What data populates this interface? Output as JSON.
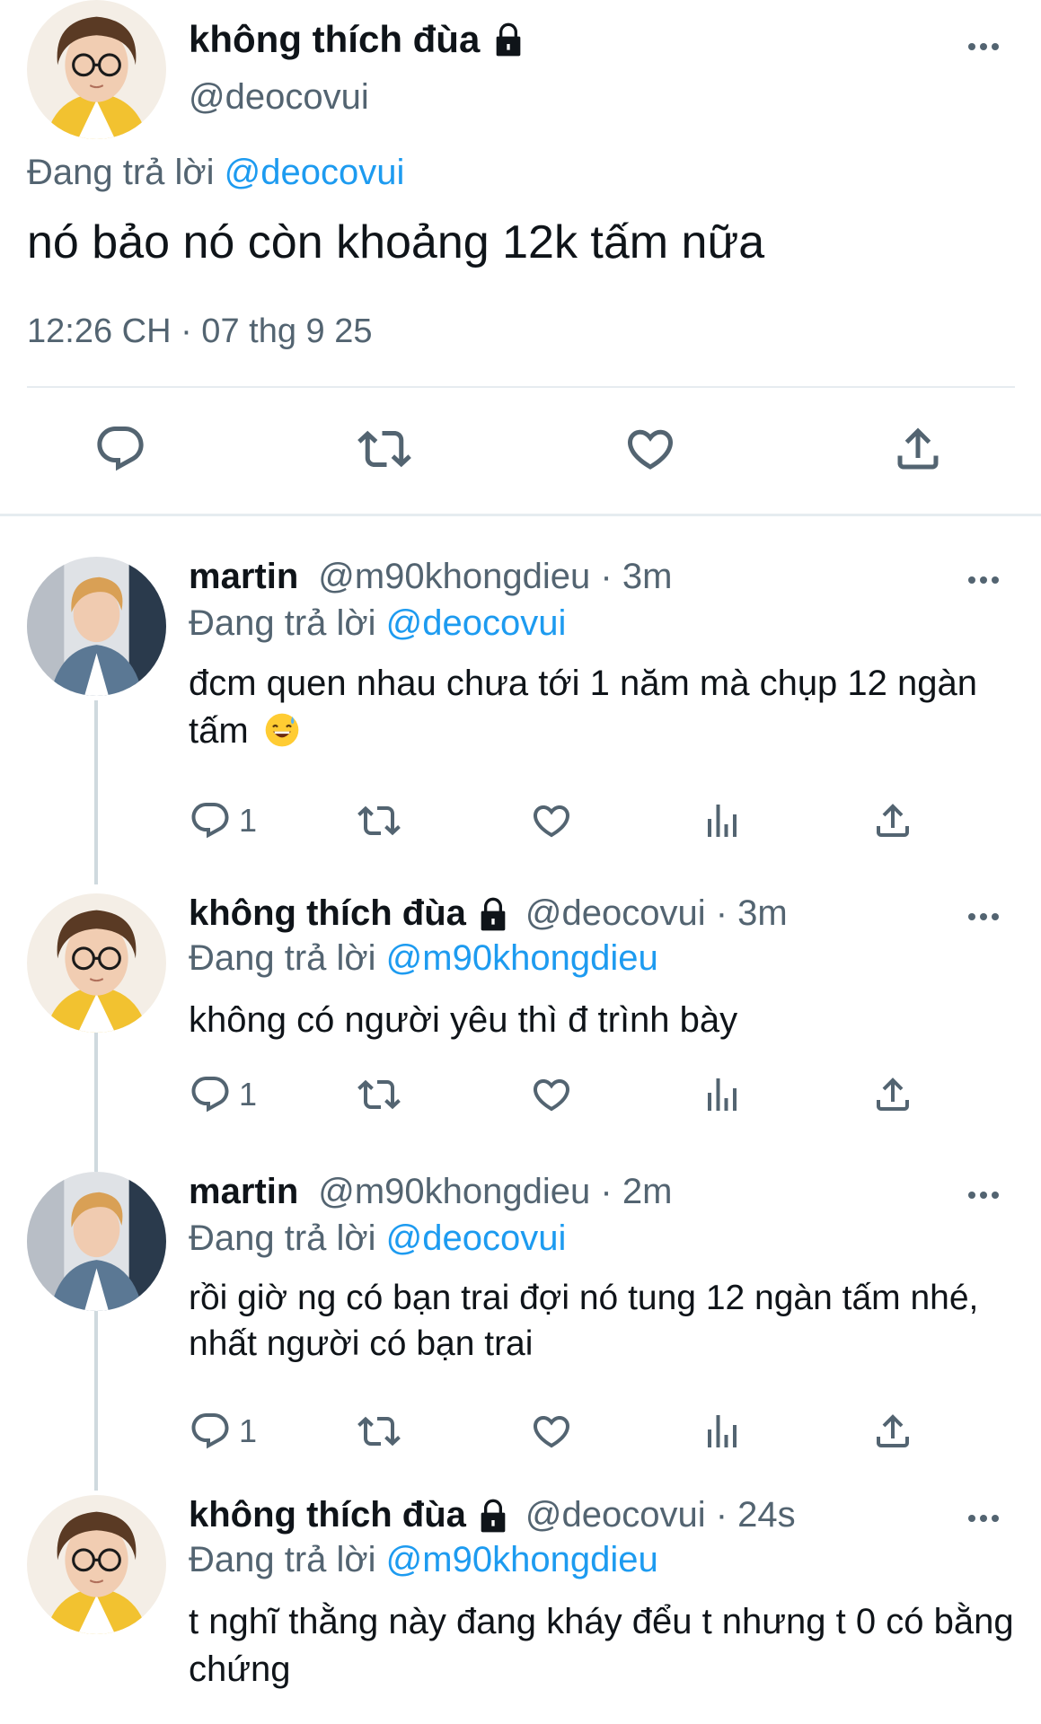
{
  "main_tweet": {
    "name": "không thích đùa",
    "handle": "@deocovui",
    "replying_prefix": "Đang trả lời",
    "replying_to": "@deocovui",
    "text": "nó bảo nó còn khoảng 12k tấm nữa",
    "timestamp": "12:26 CH · 07 thg 9 25",
    "icons": [
      "reply-icon",
      "retweet-icon",
      "like-icon",
      "share-icon"
    ]
  },
  "replies": [
    {
      "name": "martin",
      "meta": "@m90khongdieu · 3m",
      "replying_prefix": "Đang trả lời",
      "replying_to": "@deocovui",
      "text": "đcm quen nhau chưa tới 1 năm mà chụp 12 ngàn tấm",
      "emoji": "sweat-smile-emoji",
      "reply_count": "1",
      "locked": false
    },
    {
      "name": "không thích đùa",
      "meta": "@deocovui · 3m",
      "replying_prefix": "Đang trả lời",
      "replying_to": "@m90khongdieu",
      "text": "không có người yêu thì đ trình bày",
      "reply_count": "1",
      "locked": true
    },
    {
      "name": "martin",
      "meta": "@m90khongdieu · 2m",
      "replying_prefix": "Đang trả lời",
      "replying_to": "@deocovui",
      "text": "rồi giờ ng có bạn trai đợi nó tung 12 ngàn tấm nhé, nhất người có bạn trai",
      "reply_count": "1",
      "locked": false
    },
    {
      "name": "không thích đùa",
      "meta": "@deocovui · 24s",
      "replying_prefix": "Đang trả lời",
      "replying_to": "@m90khongdieu",
      "text": "t nghĩ thằng này đang kháy đểu t nhưng t 0 có bằng chứng",
      "locked": true
    }
  ],
  "colors": {
    "accent": "#1d9bf0",
    "text": "#0f1419",
    "muted": "#536471",
    "divider": "#e6ecf0",
    "thread_line": "#cfd9de"
  }
}
